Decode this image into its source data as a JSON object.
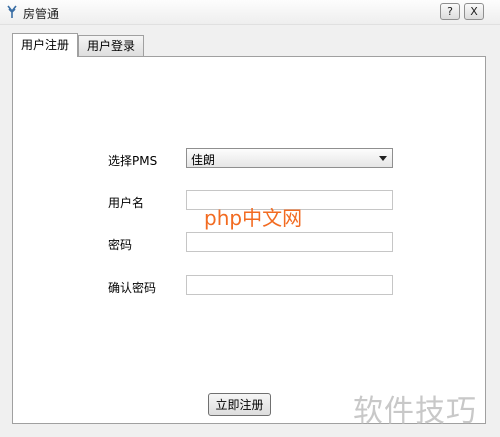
{
  "window": {
    "title": "房管通",
    "help_button": "?",
    "close_button": "X"
  },
  "tabs": [
    {
      "label": "用户注册",
      "active": true
    },
    {
      "label": "用户登录",
      "active": false
    }
  ],
  "form": {
    "pms_label": "选择PMS",
    "pms_value": "佳朗",
    "username_label": "用户名",
    "username_value": "",
    "password_label": "密码",
    "password_value": "",
    "confirm_label": "确认密码",
    "confirm_value": "",
    "submit_label": "立即注册"
  },
  "watermarks": {
    "php": "php中文网",
    "tips": "软件技巧"
  },
  "colors": {
    "window_bg": "#f0f0f0",
    "panel_bg": "#ffffff",
    "php_orange": "#f26b21"
  }
}
